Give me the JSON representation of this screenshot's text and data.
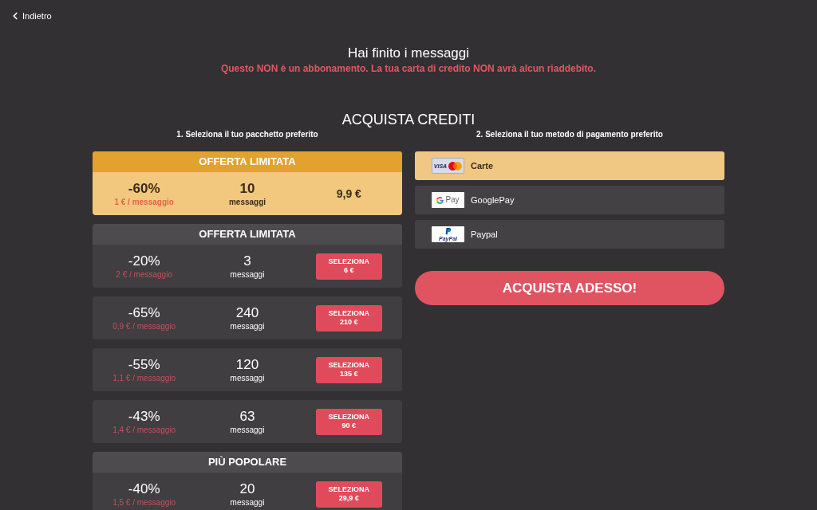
{
  "back_link": {
    "label": "Indietro"
  },
  "header": {
    "title": "Hai finito i messaggi",
    "notice": "Questo NON è un abbonamento. La tua carta di credito NON avrà alcun riaddebito."
  },
  "section_title": "ACQUISTA CREDITI",
  "packages": {
    "heading": "1. Seleziona il tuo pacchetto preferito",
    "items": [
      {
        "badge": "OFFERTA LIMITATA",
        "selected": true,
        "discount": "-60%",
        "unit_price": "1 € / messaggio",
        "count": "10",
        "count_unit": "messaggi",
        "price": "9,9 €"
      },
      {
        "badge": "OFFERTA LIMITATA",
        "selected": false,
        "discount": "-20%",
        "unit_price": "2 € / messaggio",
        "count": "3",
        "count_unit": "messaggi",
        "button_label": "SELEZIONA",
        "price": "6 €"
      },
      {
        "selected": false,
        "discount": "-65%",
        "unit_price": "0,9 € / messaggio",
        "count": "240",
        "count_unit": "messaggi",
        "button_label": "SELEZIONA",
        "price": "210 €"
      },
      {
        "selected": false,
        "discount": "-55%",
        "unit_price": "1,1 € / messaggio",
        "count": "120",
        "count_unit": "messaggi",
        "button_label": "SELEZIONA",
        "price": "135 €"
      },
      {
        "selected": false,
        "discount": "-43%",
        "unit_price": "1,4 € / messaggio",
        "count": "63",
        "count_unit": "messaggi",
        "button_label": "SELEZIONA",
        "price": "90 €"
      },
      {
        "badge": "PIÙ POPOLARE",
        "selected": false,
        "discount": "-40%",
        "unit_price": "1,5 € / messaggio",
        "count": "20",
        "count_unit": "messaggi",
        "button_label": "SELEZIONA",
        "price": "29,9 €"
      }
    ]
  },
  "payment": {
    "heading": "2. Seleziona il tuo metodo di pagamento preferito",
    "methods": [
      {
        "kind": "cards",
        "logo_text": "VISA",
        "label": "Carte",
        "selected": true
      },
      {
        "kind": "googlepay",
        "logo_text": "Pay",
        "label": "GooglePay",
        "selected": false
      },
      {
        "kind": "paypal",
        "logo_text": "PayPal",
        "label": "Paypal",
        "selected": false
      }
    ]
  },
  "buy_button": {
    "label": "ACQUISTA ADESSO!"
  }
}
